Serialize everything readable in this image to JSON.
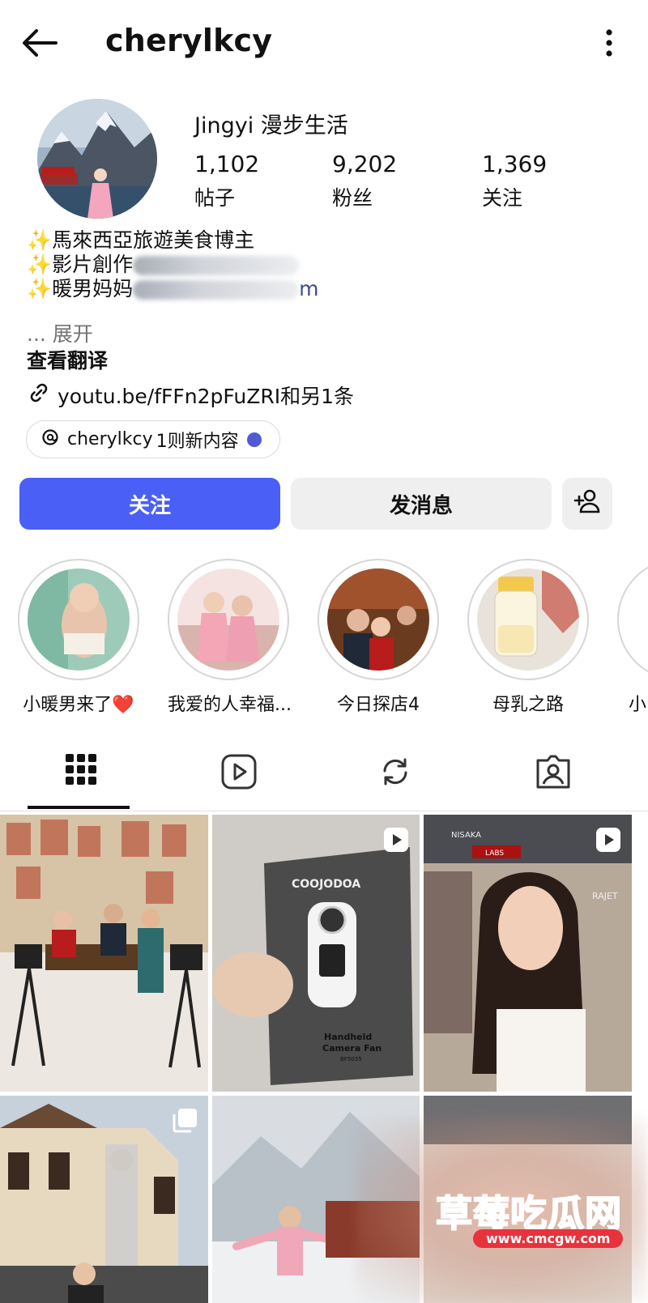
{
  "header": {
    "username": "cherylkcy"
  },
  "profile": {
    "display_name": "Jingyi 漫步生活",
    "stats": [
      {
        "value": "1,102",
        "label": "帖子"
      },
      {
        "value": "9,202",
        "label": "粉丝"
      },
      {
        "value": "1,369",
        "label": "关注"
      }
    ],
    "bio": [
      "✨馬來西亞旅遊美食博主",
      "✨影片創作",
      "✨暖男妈妈"
    ],
    "bio_tail": "m",
    "expand": "... 展开",
    "translate": "查看翻译",
    "link": "youtu.be/fFFn2pFuZRI和另1条",
    "threads": {
      "handle": "cherylkcy",
      "text": "1则新内容"
    }
  },
  "actions": {
    "follow": "关注",
    "message": "发消息"
  },
  "highlights": [
    {
      "label": "小暖男来了❤️"
    },
    {
      "label": "我爱的人幸福..."
    },
    {
      "label": "今日探店4"
    },
    {
      "label": "母乳之路"
    },
    {
      "label": "小"
    }
  ],
  "grid_posts": [
    {
      "kind": "photo"
    },
    {
      "kind": "reel",
      "text": {
        "brand": "COOJODOA",
        "line1": "Handheld",
        "line2": "Camera Fan",
        "model": "BF5035"
      }
    },
    {
      "kind": "reel",
      "text": {
        "sign1": "NISAKA",
        "sign2": "LABS",
        "sign3": "RAJET"
      }
    },
    {
      "kind": "carousel"
    },
    {
      "kind": "photo"
    },
    {
      "kind": "photo"
    }
  ],
  "watermark": {
    "title": "草莓吃瓜网",
    "url": "www.cmcgw.com"
  },
  "colors": {
    "accent": "#4a5ff5",
    "threads_dot": "#4f5bd5",
    "watermark": "#e8323c"
  }
}
